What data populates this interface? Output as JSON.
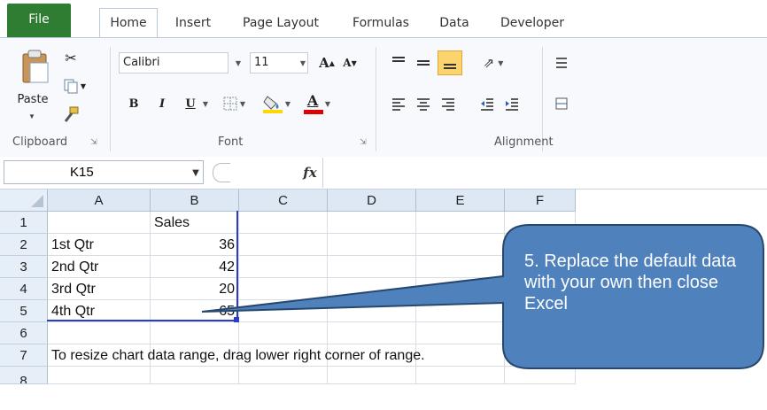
{
  "tabs": [
    "File",
    "Home",
    "Insert",
    "Page Layout",
    "Formulas",
    "Data",
    "Developer"
  ],
  "clipboard": {
    "paste_label": "Paste",
    "group_label": "Clipboard"
  },
  "font": {
    "name": "Calibri",
    "size": "11",
    "group_label": "Font",
    "bold": "B",
    "italic": "I",
    "underline": "U",
    "font_color_letter": "A"
  },
  "alignment": {
    "group_label": "Alignment"
  },
  "formula_bar": {
    "name_box": "K15",
    "fx": "fx"
  },
  "columns": [
    "A",
    "B",
    "C",
    "D",
    "E",
    "F"
  ],
  "rows": [
    "1",
    "2",
    "3",
    "4",
    "5",
    "6",
    "7",
    "8"
  ],
  "cells": {
    "b1": "Sales",
    "a2": "1st Qtr",
    "b2": "36",
    "a3": "2nd Qtr",
    "b3": "42",
    "a4": "3rd Qtr",
    "b4": "20",
    "a5": "4th Qtr",
    "b5": "65",
    "a7": "To resize chart data range, drag lower right corner of range."
  },
  "callout": {
    "text": "5. Replace the default data with your own then close Excel",
    "fill": "#4f81bd"
  },
  "colors": {
    "file_tab": "#2e7d32",
    "ribbon_bg": "#f7f9fc",
    "header_bg": "#dde8f4",
    "range_border": "#2a3cc8"
  }
}
